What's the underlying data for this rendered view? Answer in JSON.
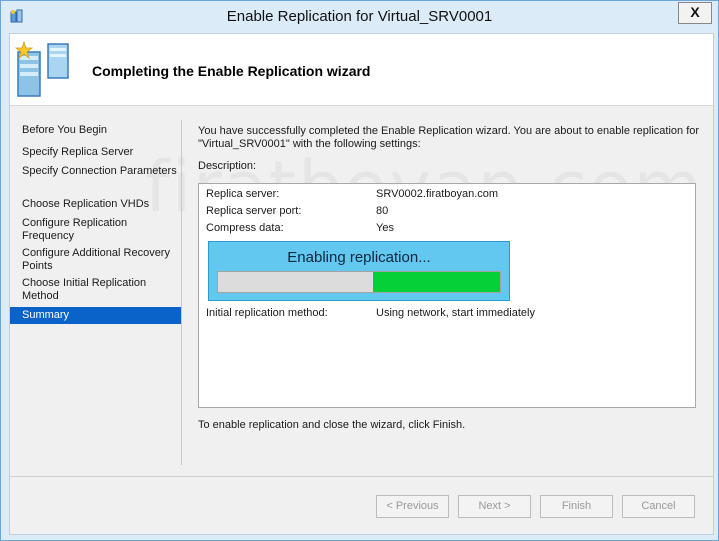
{
  "window": {
    "title": "Enable Replication for Virtual_SRV0001",
    "close_label": "X"
  },
  "header": {
    "title": "Completing the Enable Replication wizard"
  },
  "watermark": "firatboyan.com",
  "nav": {
    "items": [
      {
        "label": "Before You Begin"
      },
      {
        "label": "Specify Replica Server"
      },
      {
        "label": "Specify Connection Parameters"
      },
      {
        "label": "Choose Replication VHDs"
      },
      {
        "label": "Configure Replication Frequency"
      },
      {
        "label": "Configure Additional Recovery Points"
      },
      {
        "label": "Choose Initial Replication Method"
      },
      {
        "label": "Summary",
        "selected": true
      }
    ]
  },
  "main": {
    "intro": "You have successfully completed the Enable Replication wizard. You are about to enable replication for \"Virtual_SRV0001\" with the following settings:",
    "description_label": "Description:",
    "settings": [
      {
        "key": "Replica server:",
        "value": "SRV0002.firatboyan.com"
      },
      {
        "key": "Replica server port:",
        "value": "80"
      },
      {
        "key": "Compress data:",
        "value": "Yes"
      },
      {
        "key": "Initial replication method:",
        "value": "Using network, start immediately"
      }
    ],
    "finish_note": "To enable replication and close the wizard, click Finish."
  },
  "progress": {
    "title": "Enabling replication...",
    "fraction": 0.55
  },
  "buttons": {
    "previous": "< Previous",
    "next": "Next >",
    "finish": "Finish",
    "cancel": "Cancel"
  },
  "colors": {
    "selected": "#0a63c9",
    "progress_fill": "#06d037",
    "progress_dialog": "#63c8ef"
  }
}
